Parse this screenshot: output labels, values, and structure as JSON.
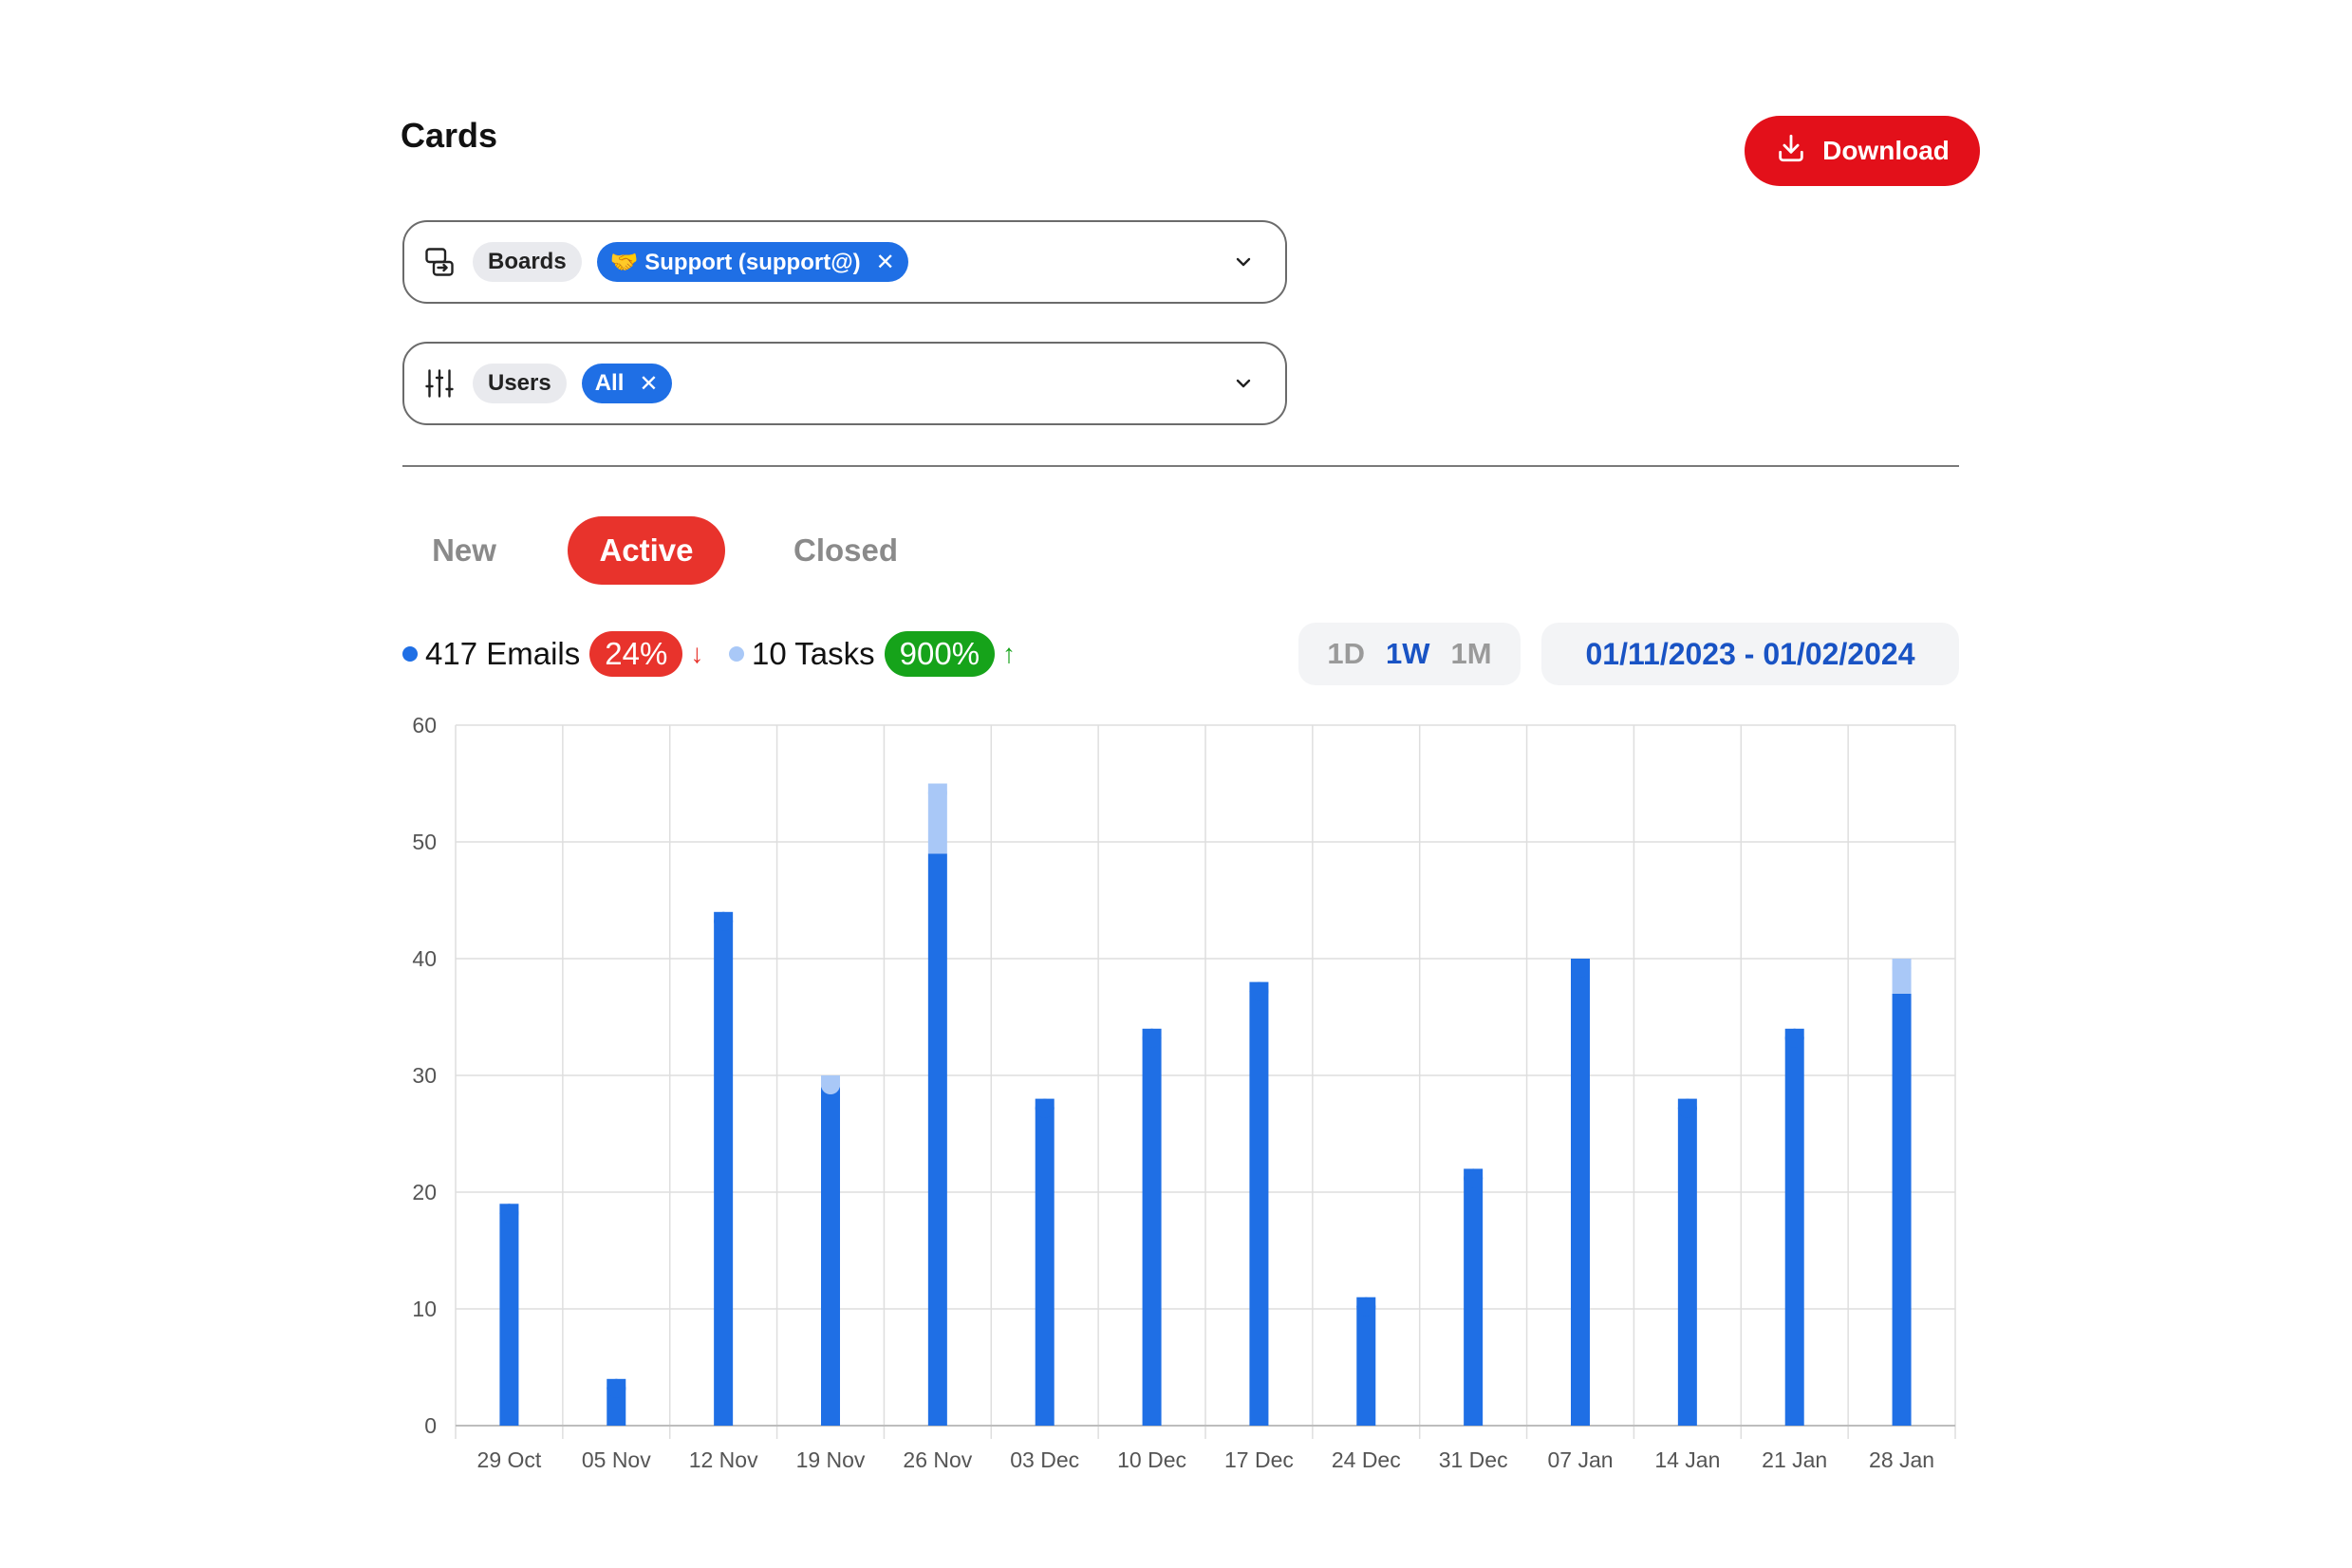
{
  "header": {
    "title": "Cards",
    "download_label": "Download"
  },
  "filters": {
    "boards": {
      "label": "Boards",
      "value": "🤝 Support (support@)"
    },
    "users": {
      "label": "Users",
      "value": "All"
    },
    "remove_glyph": "✕"
  },
  "tabs": [
    {
      "label": "New",
      "active": false
    },
    {
      "label": "Active",
      "active": true
    },
    {
      "label": "Closed",
      "active": false
    }
  ],
  "summary": {
    "emails": {
      "label": "417 Emails",
      "change": "24%",
      "direction": "↓",
      "badge_color": "#e8332c",
      "dot_color": "#1f6fe5"
    },
    "tasks": {
      "label": "10 Tasks",
      "change": "900%",
      "direction": "↑",
      "badge_color": "#16a31a",
      "dot_color": "#a9c8f7"
    }
  },
  "range": {
    "options": [
      "1D",
      "1W",
      "1M"
    ],
    "selected": "1W"
  },
  "date_range": "01/11/2023 - 01/02/2024",
  "colors": {
    "emails": "#1f6fe5",
    "tasks": "#a9c8f7",
    "grid": "#dedede",
    "axis_text": "#555555"
  },
  "chart_data": {
    "type": "bar",
    "stacked": true,
    "categories": [
      "29 Oct",
      "05 Nov",
      "12 Nov",
      "19 Nov",
      "26 Nov",
      "03 Dec",
      "10 Dec",
      "17 Dec",
      "24 Dec",
      "31 Dec",
      "07 Jan",
      "14 Jan",
      "21 Jan",
      "28 Jan"
    ],
    "series": [
      {
        "values": [
          19,
          4,
          44,
          29,
          49,
          28,
          34,
          38,
          11,
          22,
          40,
          28,
          34,
          37
        ]
      },
      {
        "values": [
          0,
          0,
          0,
          1,
          6,
          0,
          0,
          0,
          0,
          0,
          0,
          0,
          0,
          3
        ]
      }
    ],
    "yticks": [
      0,
      10,
      20,
      30,
      40,
      50,
      60
    ],
    "ylim": [
      0,
      60
    ],
    "grid": true
  }
}
